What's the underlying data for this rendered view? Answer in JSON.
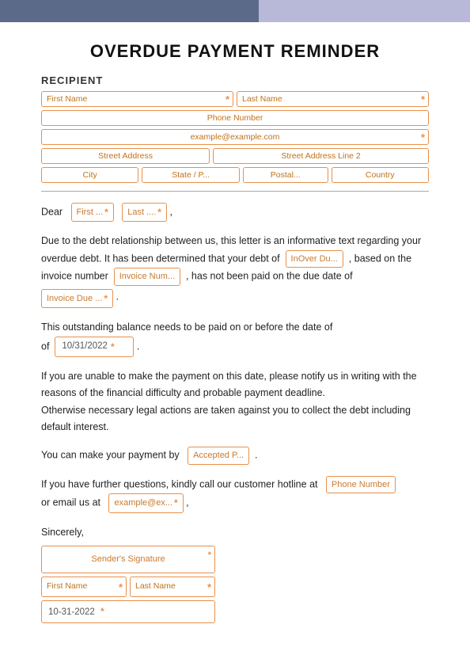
{
  "topbar": {
    "left_color": "#5c6a8a",
    "right_color": "#b8b8d8"
  },
  "title": "OVERDUE PAYMENT REMINDER",
  "recipient": {
    "label": "RECIPIENT",
    "fields": {
      "first_name": "First Name",
      "last_name": "Last Name",
      "phone": "Phone Number",
      "email": "example@example.com",
      "street1": "Street Address",
      "street2": "Street Address Line 2",
      "city": "City",
      "state": "State / P...",
      "postal": "Postal...",
      "country": "Country"
    }
  },
  "letter": {
    "dear": "Dear",
    "first_placeholder": "First ...",
    "last_placeholder": "Last ....",
    "body1": "Due to the debt relationship between us, this letter is an informative text regarding your overdue debt. It has been determined that your debt of",
    "amount_placeholder": "InOver Du...",
    "body2": ", based on the invoice number",
    "invoice_placeholder": "Invoice Num...",
    "body3": ", has not been paid on the due date of",
    "due_date_placeholder": "Invoice Due ...",
    "body4": "This outstanding balance needs to be paid on or before the date of",
    "payment_date": "10/31/2022",
    "body5": "If you are unable to make the payment on this date, please notify us in writing with the reasons of the financial difficulty and probable payment deadline.",
    "body6": "Otherwise necessary legal actions are taken against you to collect the debt including default interest.",
    "payment_line1": "You can make your payment by",
    "accepted_placeholder": "Accepted P...",
    "contact_line": "If you have further questions, kindly call our customer hotline at",
    "phone_placeholder": "Phone Number",
    "email_line": "or email us at",
    "email_placeholder": "example@ex...",
    "sincerely": "Sincerely,",
    "signature_label": "Sender's Signature",
    "sig_first": "First Name",
    "sig_last": "Last Name",
    "sig_date": "10-31-2022"
  }
}
